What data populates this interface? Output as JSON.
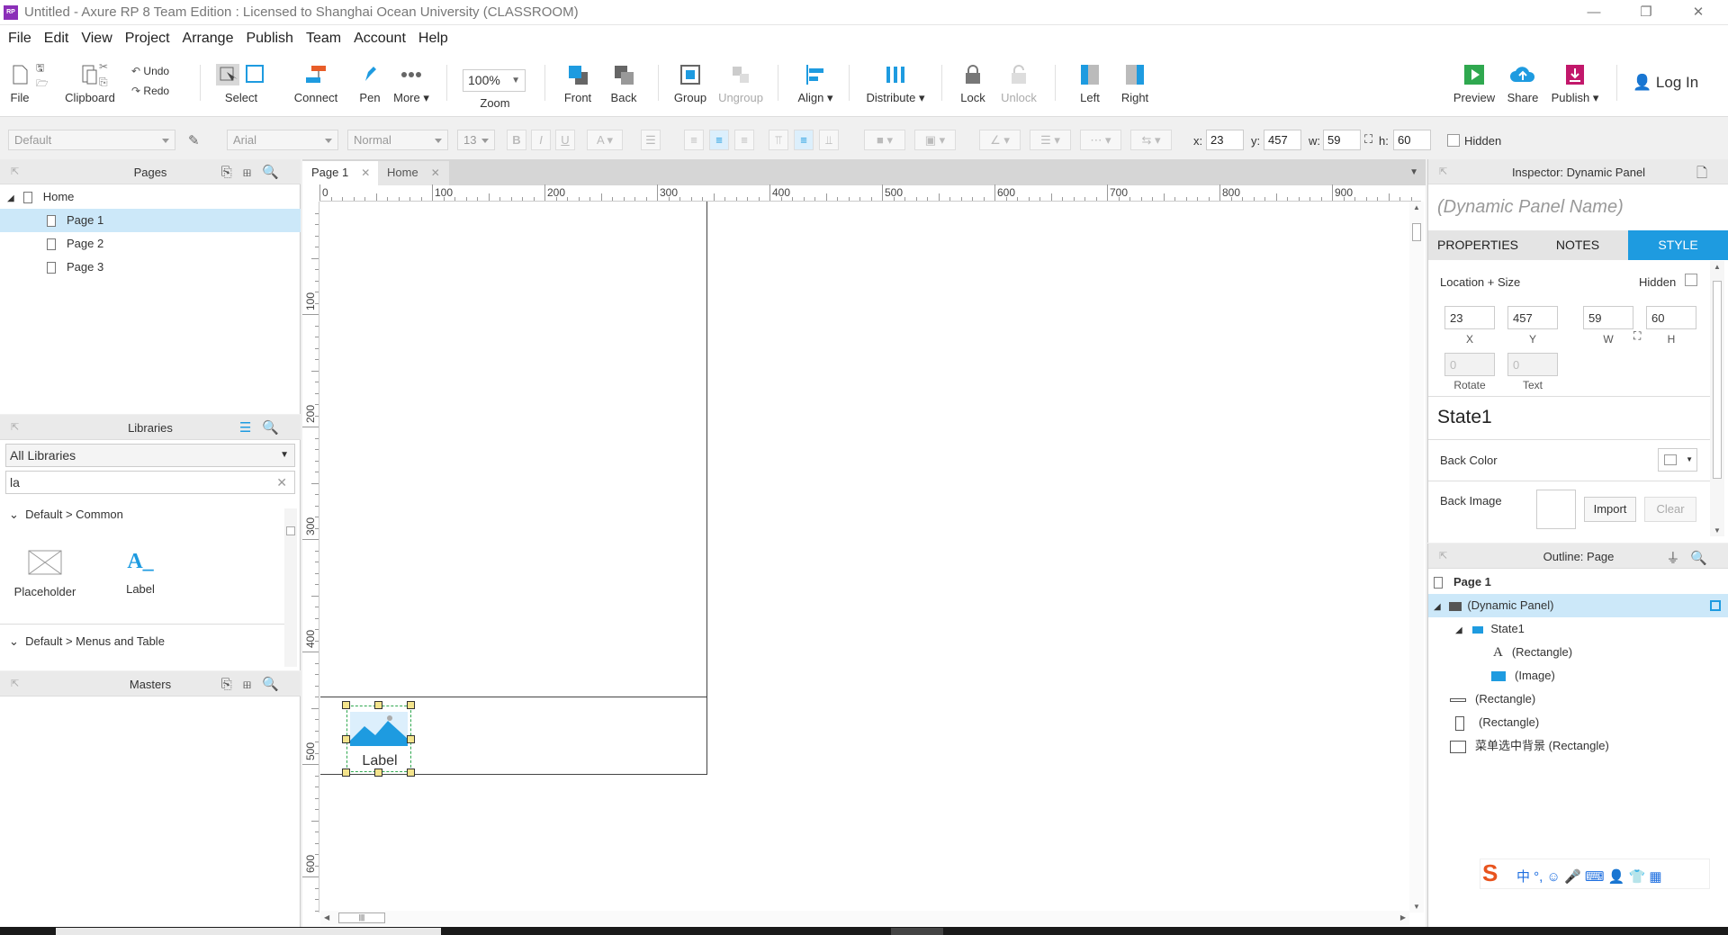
{
  "window": {
    "title": "Untitled - Axure RP 8 Team Edition : Licensed to Shanghai Ocean University (CLASSROOM)",
    "app_icon_text": "RP"
  },
  "menu": [
    "File",
    "Edit",
    "View",
    "Project",
    "Arrange",
    "Publish",
    "Team",
    "Account",
    "Help"
  ],
  "toolbar": {
    "file": "File",
    "clipboard": "Clipboard",
    "undo": "Undo",
    "redo": "Redo",
    "select": "Select",
    "connect": "Connect",
    "pen": "Pen",
    "more": "More ▾",
    "zoom_value": "100%",
    "zoom": "Zoom",
    "front": "Front",
    "back": "Back",
    "group": "Group",
    "ungroup": "Ungroup",
    "align": "Align ▾",
    "distribute": "Distribute ▾",
    "lock": "Lock",
    "unlock": "Unlock",
    "left": "Left",
    "right": "Right",
    "preview": "Preview",
    "share": "Share",
    "publish": "Publish ▾",
    "login": "Log In"
  },
  "format": {
    "style": "Default",
    "font": "Arial",
    "weight": "Normal",
    "size": "13",
    "x_label": "x:",
    "x": "23",
    "y_label": "y:",
    "y": "457",
    "w_label": "w:",
    "w": "59",
    "h_label": "h:",
    "h": "60",
    "hidden": "Hidden"
  },
  "pages": {
    "title": "Pages",
    "items": [
      "Home",
      "Page 1",
      "Page 2",
      "Page 3"
    ],
    "selected": "Page 1"
  },
  "libraries": {
    "title": "Libraries",
    "dropdown": "All Libraries",
    "search_value": "la",
    "group1": "Default > Common",
    "widget1": "Placeholder",
    "widget2": "Label",
    "group2": "Default > Menus and Table"
  },
  "masters": {
    "title": "Masters"
  },
  "doc_tabs": [
    "Page 1",
    "Home"
  ],
  "ruler": {
    "h": [
      "0",
      "100",
      "200",
      "300",
      "400",
      "500",
      "600",
      "700",
      "800",
      "900"
    ],
    "v": [
      "100",
      "200",
      "300",
      "400",
      "500",
      "600"
    ]
  },
  "canvas": {
    "widget_label": "Label"
  },
  "inspector": {
    "title": "Inspector: Dynamic Panel",
    "name_placeholder": "(Dynamic Panel Name)",
    "tabs": [
      "PROPERTIES",
      "NOTES",
      "STYLE"
    ],
    "active_tab": "STYLE",
    "location_size": "Location + Size",
    "hidden": "Hidden",
    "x": "23",
    "y": "457",
    "w": "59",
    "h": "60",
    "x_lbl": "X",
    "y_lbl": "Y",
    "w_lbl": "W",
    "h_lbl": "H",
    "rotate": "0",
    "text": "0",
    "rotate_lbl": "Rotate",
    "text_lbl": "Text",
    "state": "State1",
    "back_color": "Back Color",
    "back_image": "Back Image",
    "import": "Import",
    "clear": "Clear"
  },
  "outline": {
    "title": "Outline: Page",
    "root": "Page 1",
    "items": [
      "(Dynamic Panel)",
      "State1",
      "(Rectangle)",
      "(Image)",
      "(Rectangle)",
      "(Rectangle)",
      "菜单选中背景 (Rectangle)"
    ]
  },
  "ime": {
    "glyphs": "中 °, ☺ 🎤 ⌨ 👤 👕 ▦"
  },
  "colors": {
    "accent": "#1e9be0",
    "selected_row": "#cce8f9"
  }
}
